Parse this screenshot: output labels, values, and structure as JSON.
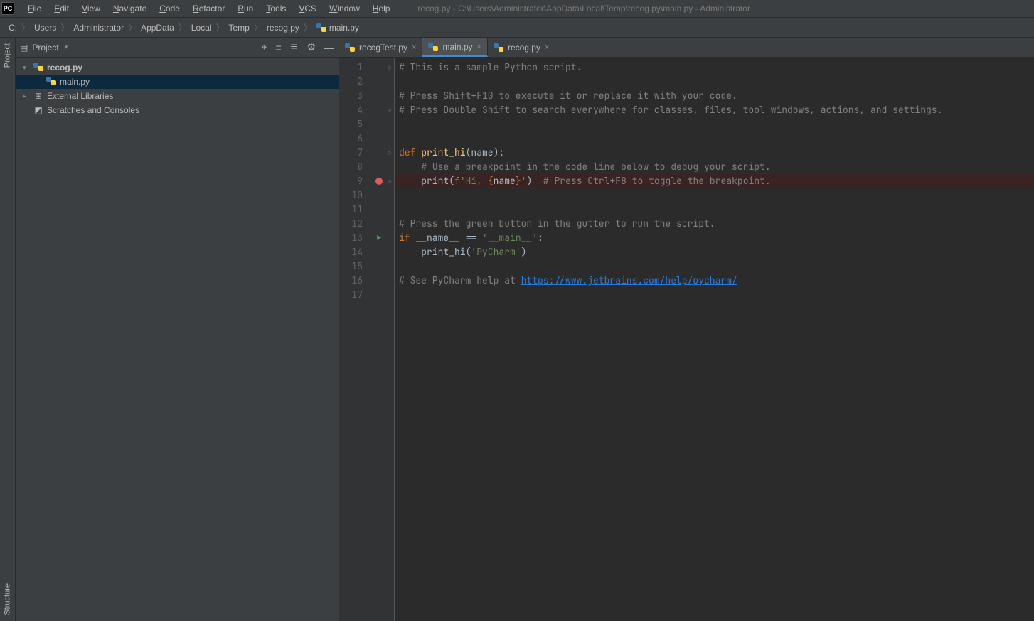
{
  "app": {
    "icon_text": "PC",
    "title": "recog.py - C:\\Users\\Administrator\\AppData\\Local\\Temp\\recog.py\\main.py - Administrator"
  },
  "menu": [
    "File",
    "Edit",
    "View",
    "Navigate",
    "Code",
    "Refactor",
    "Run",
    "Tools",
    "VCS",
    "Window",
    "Help"
  ],
  "breadcrumbs": [
    "C:",
    "Users",
    "Administrator",
    "AppData",
    "Local",
    "Temp",
    "recog.py",
    "main.py"
  ],
  "project": {
    "title": "Project",
    "tree": [
      {
        "label": "recog.py",
        "type": "project",
        "expanded": true,
        "depth": 0,
        "bold": true
      },
      {
        "label": "main.py",
        "type": "py",
        "depth": 1,
        "selected": true
      },
      {
        "label": "External Libraries",
        "type": "lib",
        "depth": 0,
        "expandable": true
      },
      {
        "label": "Scratches and Consoles",
        "type": "scratch",
        "depth": 0
      }
    ]
  },
  "tabs": [
    {
      "label": "recogTest.py",
      "active": false
    },
    {
      "label": "main.py",
      "active": true
    },
    {
      "label": "recog.py",
      "active": false
    }
  ],
  "sidetabs": {
    "top": "Project",
    "bottom": "Structure"
  },
  "code": {
    "lines": [
      {
        "n": 1,
        "fold": "⊖",
        "html": "<span class='c-comment'># This is a sample Python script.</span>"
      },
      {
        "n": 2,
        "html": ""
      },
      {
        "n": 3,
        "html": "<span class='c-comment'># Press Shift+F10 to execute it or replace it with your code.</span>"
      },
      {
        "n": 4,
        "fold": "⊖",
        "html": "<span class='c-comment'># Press Double Shift to search everywhere for classes, files, tool windows, actions, and settings.</span>"
      },
      {
        "n": 5,
        "html": ""
      },
      {
        "n": 6,
        "html": ""
      },
      {
        "n": 7,
        "fold": "⊖",
        "html": "<span class='c-keyword'>def </span><span class='c-func'>print_hi</span>(name):"
      },
      {
        "n": 8,
        "html": "    <span class='c-comment'># Use a breakpoint in the code line below to debug your script.</span>"
      },
      {
        "n": 9,
        "bp": true,
        "fold": "⊖",
        "html": "    print(<span class='c-prefix'>f</span><span class='c-string'>'Hi, </span><span class='c-brace'>{</span>name<span class='c-brace'>}</span><span class='c-string'>'</span>)  <span class='c-comment'># Press Ctrl+F8 to toggle the breakpoint.</span>"
      },
      {
        "n": 10,
        "html": ""
      },
      {
        "n": 11,
        "html": ""
      },
      {
        "n": 12,
        "html": "<span class='c-comment'># Press the green button in the gutter to run the script.</span>"
      },
      {
        "n": 13,
        "run": true,
        "html": "<span class='c-keyword'>if </span>__name__ == <span class='c-string'>'__main__'</span>:"
      },
      {
        "n": 14,
        "html": "    print_hi(<span class='c-string'>'PyCharm'</span>)"
      },
      {
        "n": 15,
        "html": ""
      },
      {
        "n": 16,
        "html": "<span class='c-comment'># See PyCharm help at </span><span class='c-link'>https://www.jetbrains.com/help/pycharm/</span>"
      },
      {
        "n": 17,
        "html": ""
      }
    ]
  }
}
